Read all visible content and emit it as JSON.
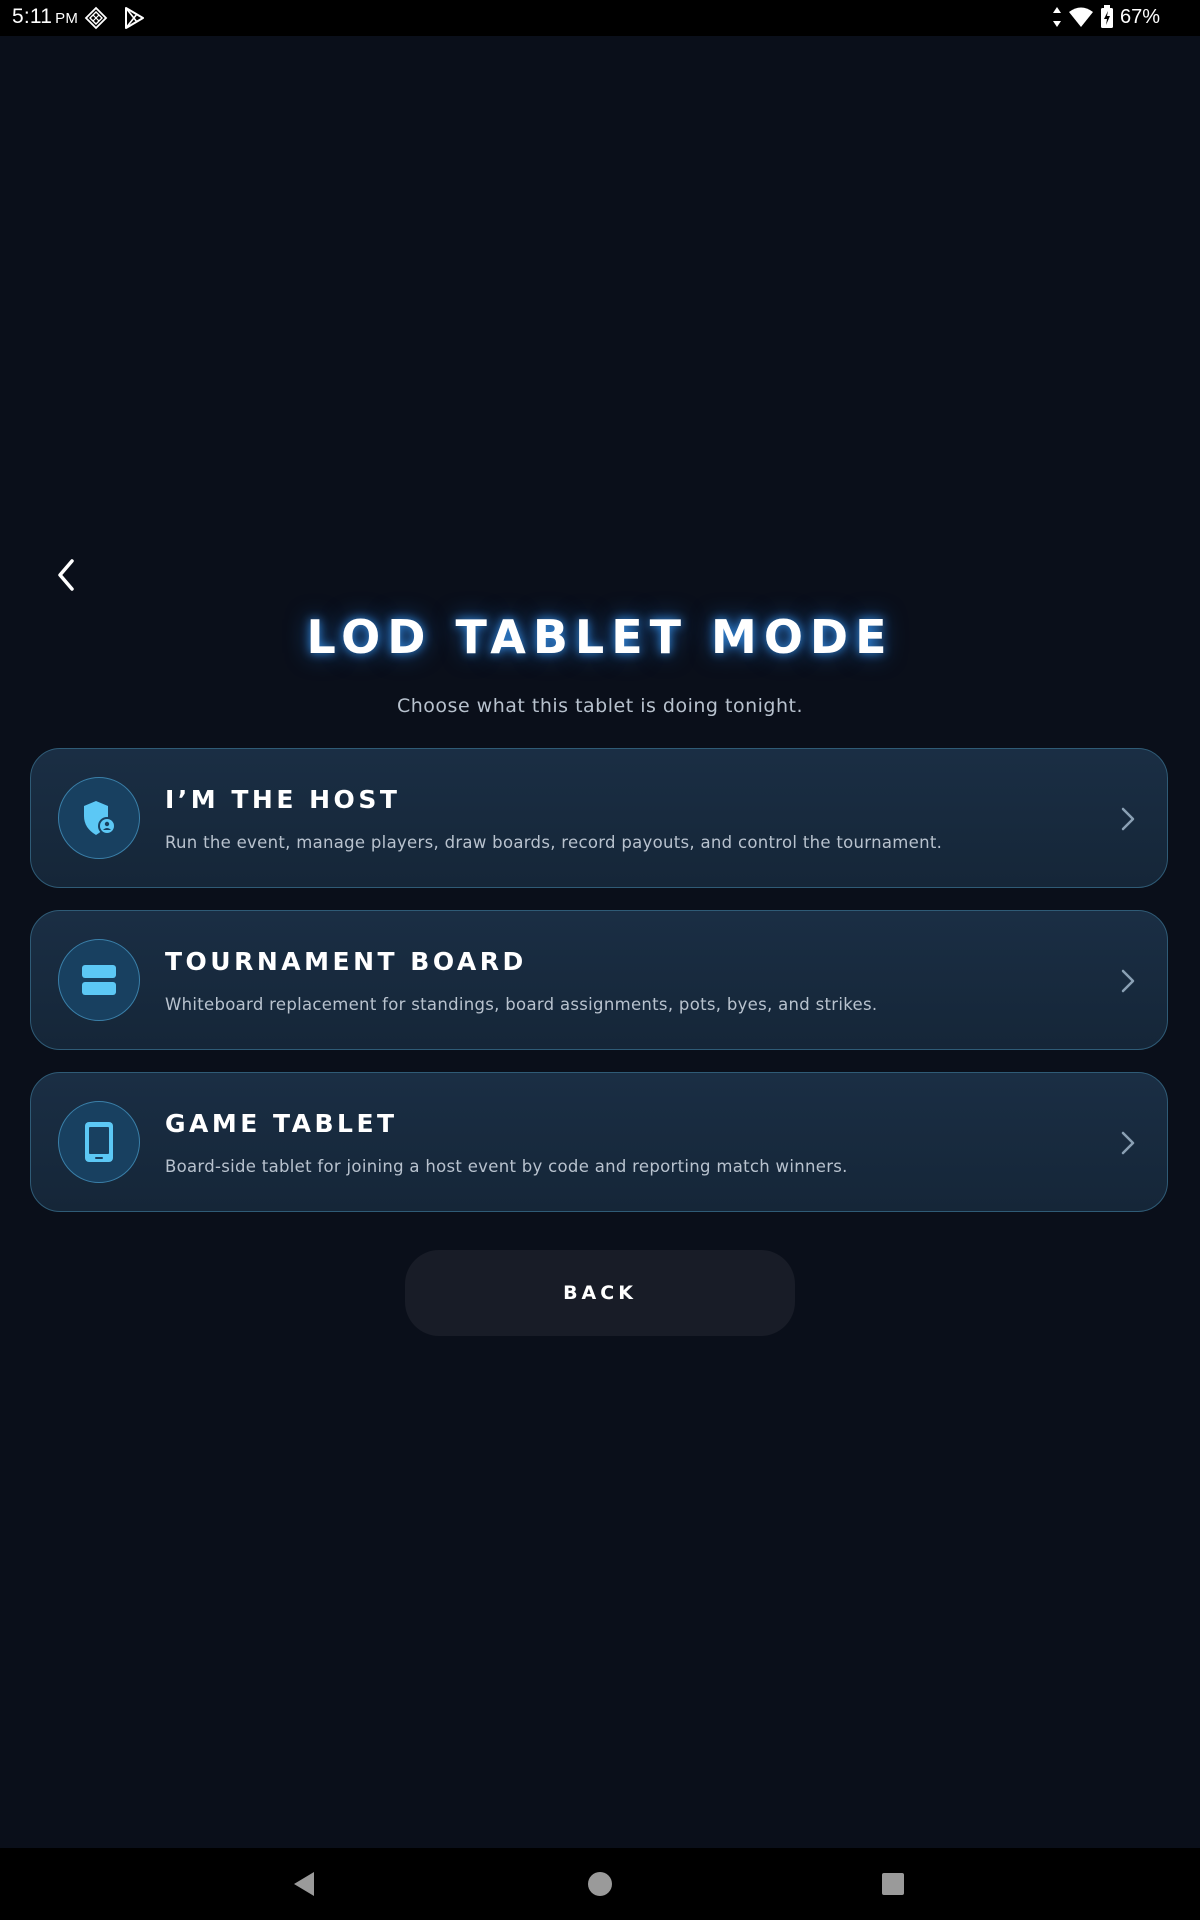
{
  "status_bar": {
    "time": "5:11",
    "ampm": "PM",
    "battery": "67%"
  },
  "header": {
    "title": "LOD TABLET MODE",
    "subtitle": "Choose what this tablet is doing tonight."
  },
  "modes": [
    {
      "title": "I’M THE HOST",
      "description": "Run the event, manage players, draw boards, record payouts, and control the tournament.",
      "icon": "shield-user-icon"
    },
    {
      "title": "TOURNAMENT BOARD",
      "description": "Whiteboard replacement for standings, board assignments, pots, byes, and strikes.",
      "icon": "board-icon"
    },
    {
      "title": "GAME TABLET",
      "description": "Board-side tablet for joining a host event by code and reporting match winners.",
      "icon": "tablet-icon"
    }
  ],
  "footer": {
    "back_label": "BACK"
  },
  "colors": {
    "background": "#0a0f1a",
    "accent": "#5cc8f5",
    "card_border": "#2f5b76",
    "card_bg": "#1a2e44"
  }
}
